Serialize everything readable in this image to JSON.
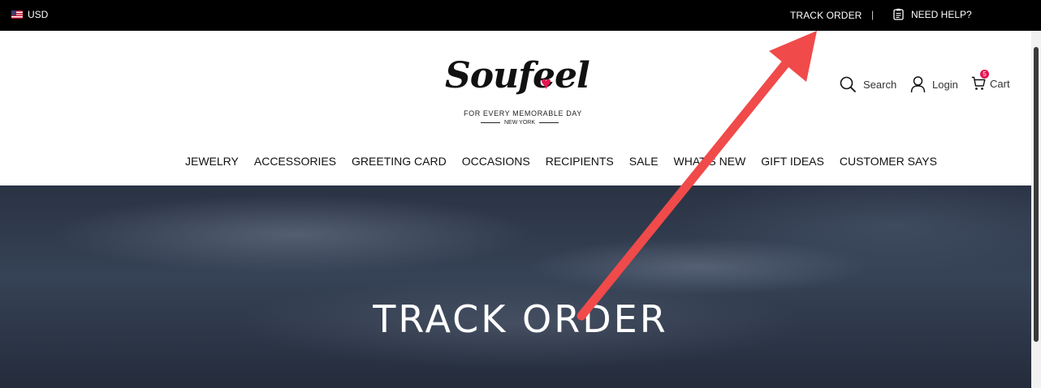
{
  "topbar": {
    "currency": "USD",
    "currency_flag_icon": "us-flag-icon",
    "track_order": "TRACK ORDER",
    "separator": "|",
    "need_help": "NEED HELP?"
  },
  "header": {
    "logo": {
      "wordmark": "Soufeel",
      "tagline": "FOR EVERY MEMORABLE DAY",
      "city": "NEW YORK",
      "accent_color": "#e3144f"
    },
    "utilities": {
      "search_label": "Search",
      "login_label": "Login",
      "cart_label": "Cart",
      "cart_count": "5"
    },
    "nav": [
      "JEWELRY",
      "ACCESSORIES",
      "GREETING CARD",
      "OCCASIONS",
      "RECIPIENTS",
      "SALE",
      "WHAT'S NEW",
      "GIFT IDEAS",
      "CUSTOMER SAYS"
    ]
  },
  "hero": {
    "title": "TRACK ORDER"
  },
  "colors": {
    "topbar_bg": "#000000",
    "annotation_arrow": "#f04a4a"
  }
}
